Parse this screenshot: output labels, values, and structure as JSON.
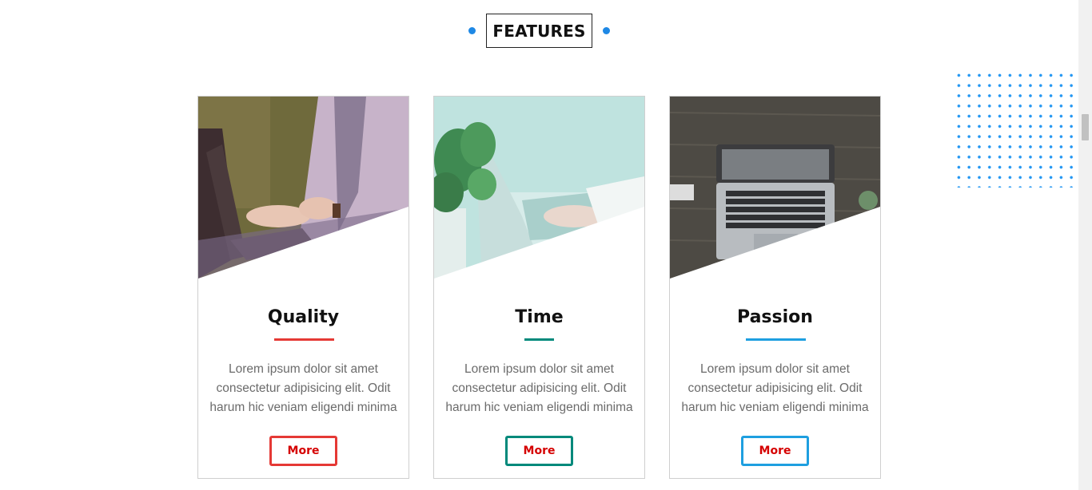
{
  "section": {
    "heading": "FEATURES",
    "accent": "#1e88e5"
  },
  "cards": [
    {
      "title": "Quality",
      "text": "Lorem ipsum dolor sit amet consectetur adipisicing elit. Odit harum hic veniam eligendi minima",
      "button": "More",
      "accent": "#e53935",
      "image": "woman-laptop-photo"
    },
    {
      "title": "Time",
      "text": "Lorem ipsum dolor sit amet consectetur adipisicing elit. Odit harum hic veniam eligendi minima",
      "button": "More",
      "accent": "#00897b",
      "image": "plant-laptop-photo"
    },
    {
      "title": "Passion",
      "text": "Lorem ipsum dolor sit amet consectetur adipisicing elit. Odit harum hic veniam eligendi minima",
      "button": "More",
      "accent": "#1e9fe0",
      "image": "desk-laptop-photo"
    }
  ]
}
